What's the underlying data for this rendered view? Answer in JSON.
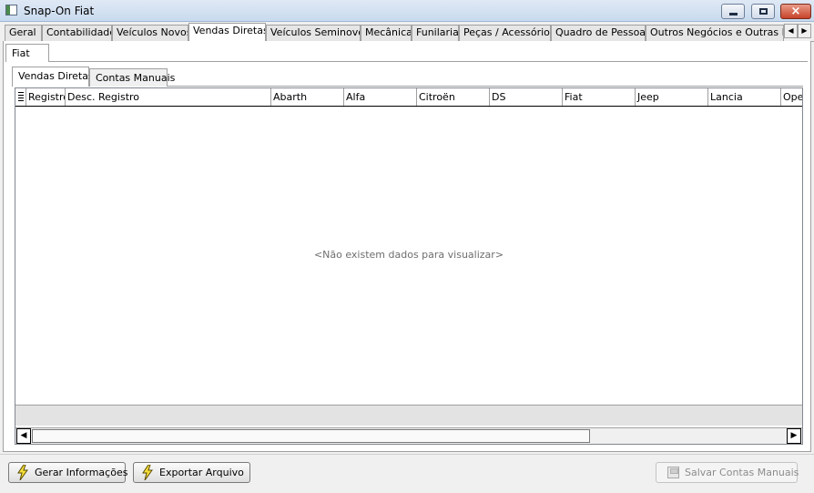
{
  "window": {
    "title": "Snap-On Fiat",
    "controls": {
      "minimize": "minimize",
      "maximize": "maximize",
      "close": "×"
    }
  },
  "main_tabs": [
    {
      "label": "Geral"
    },
    {
      "label": "Contabilidade"
    },
    {
      "label": "Veículos Novos"
    },
    {
      "label": "Vendas Diretas",
      "active": true
    },
    {
      "label": "Veículos Seminovos"
    },
    {
      "label": "Mecânica"
    },
    {
      "label": "Funilaria"
    },
    {
      "label": "Peças / Acessórios"
    },
    {
      "label": "Quadro de Pessoas"
    },
    {
      "label": "Outros Negócios e Outras Mar"
    }
  ],
  "tab_scroll": {
    "left": "◀",
    "right": "▶"
  },
  "brand_tab": {
    "label": "Fiat"
  },
  "sub_tabs": [
    {
      "label": "Vendas Diretas",
      "active": true
    },
    {
      "label": "Contas Manuais"
    }
  ],
  "grid": {
    "columns": [
      "Registro",
      "Desc. Registro",
      "Abarth",
      "Alfa",
      "Citroën",
      "DS",
      "Fiat",
      "Jeep",
      "Lancia",
      "Opel"
    ],
    "empty_message": "<Não existem dados para visualizar>",
    "scroll": {
      "left": "◀",
      "right": "▶"
    }
  },
  "buttons": {
    "gerar": "Gerar Informações",
    "exportar": "Exportar Arquivo",
    "salvar": "Salvar Contas Manuais"
  }
}
